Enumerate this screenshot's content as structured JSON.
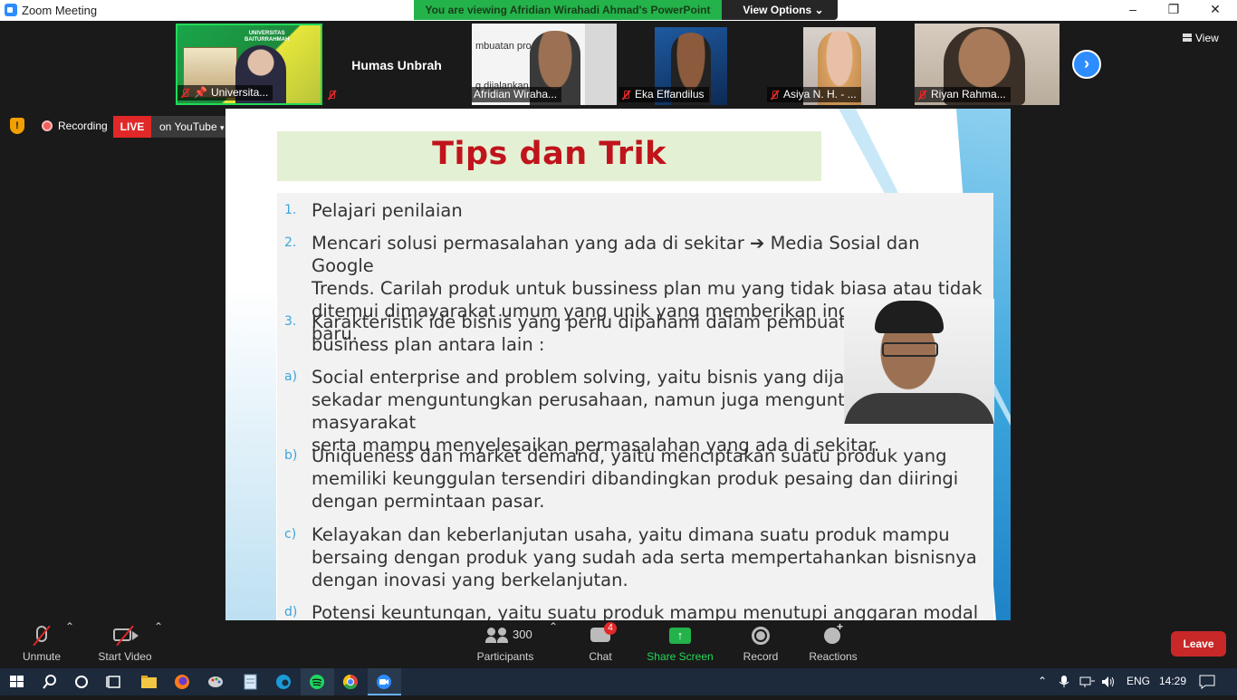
{
  "window": {
    "title": "Zoom Meeting",
    "minimize": "–",
    "restore": "❐",
    "close": "✕"
  },
  "share_banner": {
    "viewing_text": "You are viewing Afridian Wirahadi Ahmad's PowerPoint",
    "view_options_label": "View Options"
  },
  "participants_strip": [
    {
      "name": "Universita...",
      "muted": true
    },
    {
      "name": "Humas Unbrah",
      "display_name": "Humas Unbrah",
      "muted": true
    },
    {
      "name": "Afridian Wiraha...",
      "muted": false
    },
    {
      "name": "Eka Effandilus",
      "muted": true
    },
    {
      "name": "Asiya N. H. - ...",
      "muted": true
    },
    {
      "name": "Riyan Rahma...",
      "muted": true
    }
  ],
  "thumb_overlays": {
    "univ_logo": "UNIVERSITAS\nBAITURRAHMAH",
    "afridian_slide": "mbuatan pro\n\ng dijalankan"
  },
  "view_label": "View",
  "recording": {
    "label": "Recording",
    "live_label": "LIVE",
    "stream_label": "on YouTube"
  },
  "slide": {
    "title": "Tips dan Trik",
    "items": [
      {
        "marker": "1.",
        "text": "Pelajari penilaian"
      },
      {
        "marker": "2.",
        "text": "Mencari solusi permasalahan yang ada di sekitar ➔ Media Sosial dan Google\nTrends. Carilah produk untuk bussiness plan mu yang tidak biasa atau tidak\nditemui dimayarakat umum yang unik yang memberikan inovasi-inovasi baru."
      },
      {
        "marker": "3.",
        "text": "Karakteristik ide bisnis yang perlu dipahami dalam pembuatan pro\nbusiness plan antara lain :"
      },
      {
        "marker": "a)",
        "text": "Social enterprise and problem solving, yaitu bisnis yang dijalankan\nsekadar menguntungkan perusahaan, namun juga menguntungkan masyarakat\nserta mampu menyelesaikan permasalahan yang ada di sekitar."
      },
      {
        "marker": "b)",
        "text": "Uniqueness dan market demand, yaitu menciptakan suatu produk yang\nmemiliki keunggulan tersendiri dibandingkan produk pesaing dan diiringi\ndengan permintaan pasar."
      },
      {
        "marker": "c)",
        "text": "Kelayakan dan keberlanjutan usaha, yaitu dimana suatu produk mampu\nbersaing dengan produk yang sudah ada serta mempertahankan bisnisnya\ndengan inovasi yang berkelanjutan."
      },
      {
        "marker": "d)",
        "text": "Potensi keuntungan, yaitu suatu produk mampu menutupi anggaran modal"
      }
    ]
  },
  "toolbar": {
    "unmute_label": "Unmute",
    "start_video_label": "Start Video",
    "participants_label": "Participants",
    "participants_count": "300",
    "chat_label": "Chat",
    "chat_badge": "4",
    "share_screen_label": "Share Screen",
    "record_label": "Record",
    "reactions_label": "Reactions",
    "leave_label": "Leave"
  },
  "taskbar": {
    "language": "ENG",
    "time": "14:29"
  },
  "colors": {
    "zoom_blue": "#2d8cff",
    "share_green": "#23b34a",
    "live_red": "#e02828",
    "slide_title_red": "#c0141c",
    "leave_red": "#c82828"
  }
}
